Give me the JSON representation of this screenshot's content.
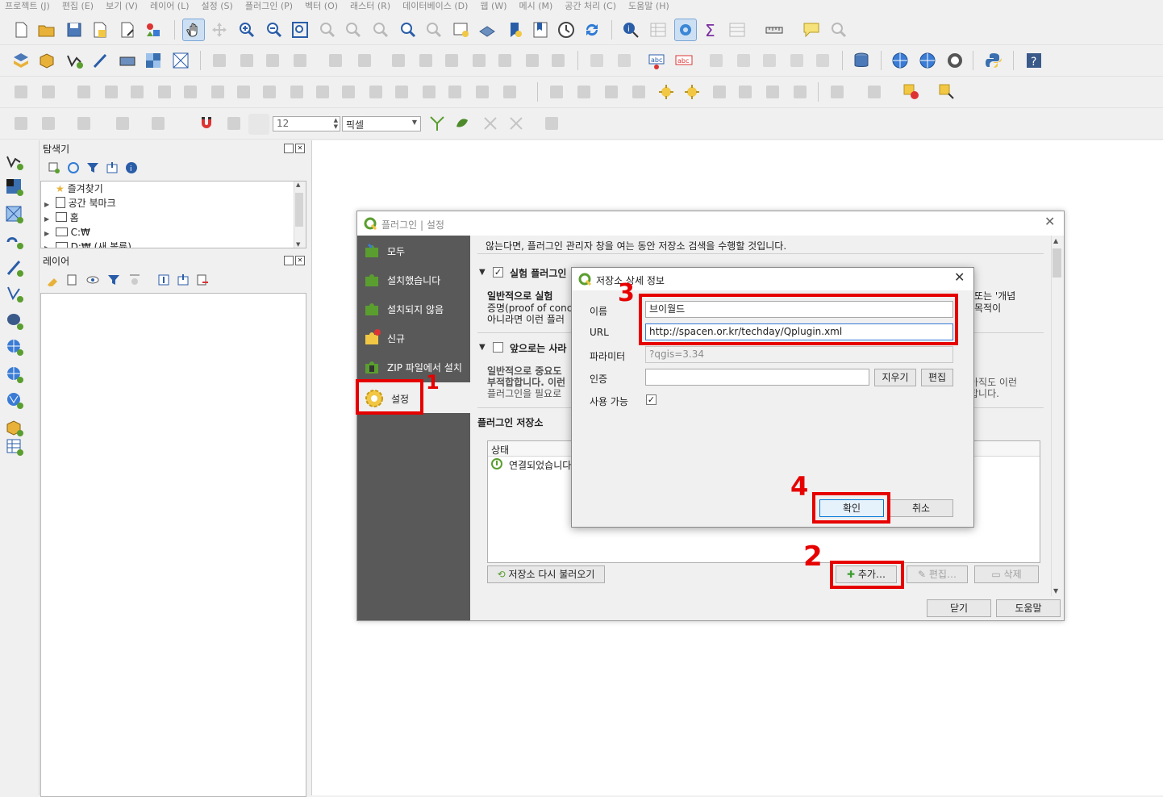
{
  "menubar": [
    "프로젝트 (J)",
    "편집 (E)",
    "보기 (V)",
    "레이어 (L)",
    "설정 (S)",
    "플러그인 (P)",
    "벡터 (O)",
    "래스터 (R)",
    "데이터베이스 (D)",
    "웹 (W)",
    "메시 (M)",
    "공간 처리 (C)",
    "도움말 (H)"
  ],
  "snapping": {
    "tolerance": "12",
    "unit": "픽셀"
  },
  "browser_panel": {
    "title": "탐색기",
    "items": [
      "즐겨찾기",
      "공간 북마크",
      "홈",
      "C:₩",
      "D:₩ (새 볼륨)"
    ]
  },
  "layers_panel": {
    "title": "레이어"
  },
  "plugin_dialog": {
    "title": "플러그인 | 설정",
    "sidebar": [
      "모두",
      "설치했습니다",
      "설치되지 않음",
      "신규",
      "ZIP 파일에서 설치",
      "설정"
    ],
    "active_index": 5,
    "top_text": "않는다면, 플러그인 관리자 창을 여는 동안 저장소 검색을 수행할 것입니다.",
    "experimental": {
      "label": "실험 플러그인",
      "checked": "✓",
      "text_bold": "일반적으로 실험",
      "text_lines": [
        "증명(proof of conc",
        "아니라면 이런 플러"
      ],
      "right_lines": [
        "또는 '개념",
        "목적이"
      ]
    },
    "deprecated": {
      "label": "앞으로는 사라",
      "text_bold_lines": [
        "일반적으로 중요도",
        "부적합합니다. 이런"
      ],
      "text_line": "플러그인을 필요로",
      "right_lines": [
        "아직도 이런",
        "합니다."
      ]
    },
    "repos_title": "플러그인 저장소",
    "table_header": "상태",
    "row_status": "연결되었습니다",
    "buttons": {
      "reload": "저장소 다시 불러오기",
      "add": "추가…",
      "edit": "편집…",
      "delete": "삭제"
    },
    "footer": {
      "close": "닫기",
      "help": "도움말"
    }
  },
  "repo_dialog": {
    "title": "저장소 상세 정보",
    "labels": {
      "name": "이름",
      "url": "URL",
      "params": "파라미터",
      "auth": "인증",
      "enabled": "사용 가능"
    },
    "name_value": "브이월드",
    "url_value": "http://spacen.or.kr/techday/Qplugin.xml",
    "params_placeholder": "?qgis=3.34",
    "auth_value": "",
    "enabled_check": "✓",
    "clear_btn": "지우기",
    "edit_btn": "편집",
    "ok_btn": "확인",
    "cancel_btn": "취소"
  },
  "annotations": [
    "1",
    "2",
    "3",
    "4"
  ],
  "colors": {
    "highlight": "#e60000",
    "sidebar": "#595959",
    "qgis_green": "#5a9e2f"
  }
}
